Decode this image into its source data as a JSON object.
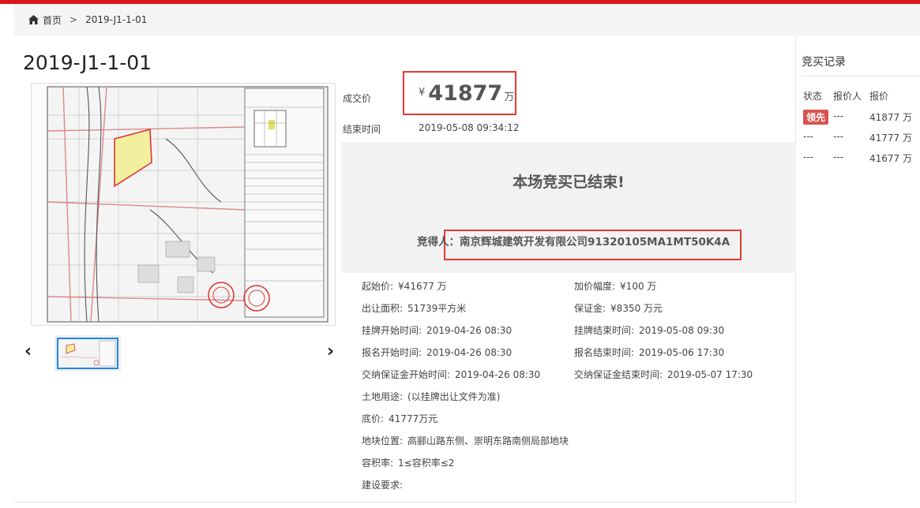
{
  "breadcrumb": {
    "home": "首页",
    "separator": ">",
    "current": "2019-J1-1-01"
  },
  "lot": {
    "title": "2019-J1-1-01"
  },
  "deal": {
    "label": "成交价",
    "currency": "¥",
    "price": "41877",
    "unit": "万",
    "end_label": "结束时间",
    "end_time": "2019-05-08 09:34:12"
  },
  "status": {
    "ended_text": "本场竞买已结束!",
    "winner_label": "竞得人：",
    "winner_name": "南京辉城建筑开发有限公司91320105MA1MT50K4A"
  },
  "details": {
    "start_price": {
      "k": "起始价:",
      "v": "¥41677 万"
    },
    "increment": {
      "k": "加价幅度:",
      "v": "¥100 万"
    },
    "area": {
      "k": "出让面积:",
      "v": "51739平方米"
    },
    "deposit": {
      "k": "保证金:",
      "v": "¥8350 万元"
    },
    "list_start": {
      "k": "挂牌开始时间:",
      "v": "2019-04-26 08:30"
    },
    "list_end": {
      "k": "挂牌结束时间:",
      "v": "2019-05-08 09:30"
    },
    "reg_start": {
      "k": "报名开始时间:",
      "v": "2019-04-26 08:30"
    },
    "reg_end": {
      "k": "报名结束时间:",
      "v": "2019-05-06 17:30"
    },
    "dep_start": {
      "k": "交纳保证金开始时间:",
      "v": "2019-04-26 08:30"
    },
    "dep_end": {
      "k": "交纳保证金结束时间:",
      "v": "2019-05-07 17:30"
    },
    "usage": {
      "k": "土地用途:",
      "v": "(以挂牌出让文件为准)"
    },
    "reserve": {
      "k": "底价:",
      "v": "41777万元"
    },
    "location": {
      "k": "地块位置:",
      "v": "高郦山路东侧、崇明东路南侧局部地块"
    },
    "far": {
      "k": "容积率:",
      "v": "1≤容积率≤2"
    },
    "build_req": {
      "k": "建设要求:",
      "v": ""
    }
  },
  "bids": {
    "title": "竞买记录",
    "headers": [
      "状态",
      "报价人",
      "报价"
    ],
    "rows": [
      {
        "status": "领先",
        "bidder": "---",
        "price": "41877 万"
      },
      {
        "status": "---",
        "bidder": "---",
        "price": "41777 万"
      },
      {
        "status": "---",
        "bidder": "---",
        "price": "41677 万"
      }
    ]
  },
  "colors": {
    "accent_red": "#d9171c",
    "highlight_box": "#e53935",
    "thumb_border": "#1e88e5",
    "badge": "#d9534f"
  },
  "icons": {
    "home": "home-icon",
    "prev": "chevron-left-icon",
    "next": "chevron-right-icon"
  }
}
